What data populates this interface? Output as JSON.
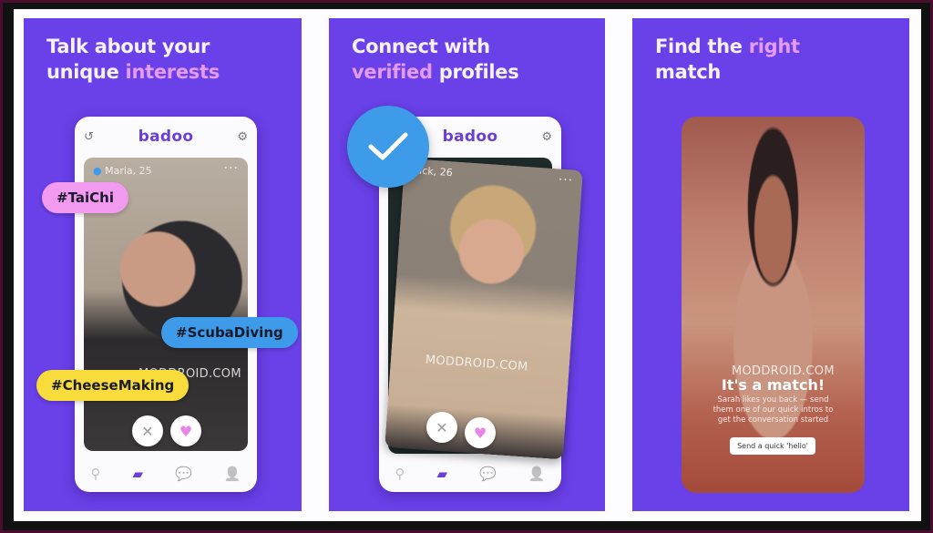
{
  "panels": [
    {
      "headline_line1": "Talk about your",
      "headline_line2_plain": "unique ",
      "headline_line2_highlight": "interests",
      "app": {
        "brand": "badoo",
        "profile_name": "Maria, 25",
        "tags": [
          {
            "label": "#TaiChi",
            "color": "#f29af0"
          },
          {
            "label": "#ScubaDiving",
            "color": "#3d9be9"
          },
          {
            "label": "#CheeseMaking",
            "color": "#f8dc3c"
          }
        ],
        "watermark": "MODDROID.COM"
      }
    },
    {
      "headline_line1": "Connect with",
      "headline_line2_highlight": "verified",
      "headline_line2_plain": " profiles",
      "app": {
        "brand": "badoo",
        "profile_name": "Jack, 26",
        "verified_badge": "checkmark",
        "watermark": "MODDROID.COM"
      }
    },
    {
      "headline_line1_plain": "Find the ",
      "headline_line1_highlight": "right",
      "headline_line2": "match",
      "app": {
        "match_title": "It's a match!",
        "match_subtitle": "Sarah likes you back — send them one of our quick intros to get the conversation started",
        "send_button": "Send a quick 'hello'",
        "watermark": "MODDROID.COM"
      }
    }
  ],
  "icons": {
    "undo": "↺",
    "filters": "⚙",
    "more": "···",
    "pass": "✕",
    "like": "♥",
    "tab_location": "⚲",
    "tab_cards": "▰",
    "tab_chat": "💬",
    "tab_profile": "👤",
    "check": "✓"
  },
  "colors": {
    "panel_bg": "#6a40e8",
    "highlight_text": "#e59bf2",
    "brand": "#6a3fd6",
    "verified_blue": "#3d9be9"
  }
}
